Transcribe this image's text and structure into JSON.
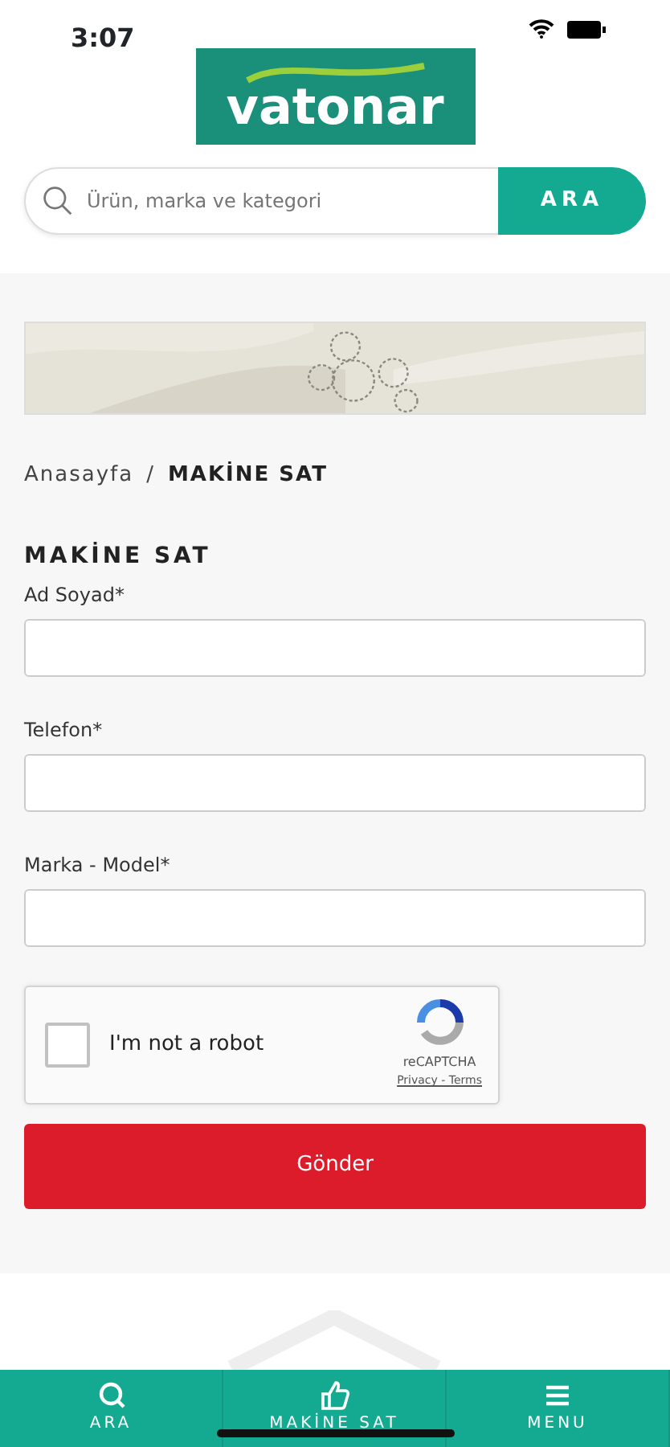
{
  "status_bar": {
    "time": "3:07"
  },
  "logo": {
    "text": "vatonar"
  },
  "search": {
    "placeholder": "Ürün, marka ve kategori",
    "button": "ARA"
  },
  "breadcrumb": [
    {
      "label": "Anasayfa",
      "current": false
    },
    {
      "label": "MAKİNE SAT",
      "current": true
    }
  ],
  "breadcrumb_separator": "/",
  "form": {
    "title": "MAKİNE SAT",
    "fields": [
      {
        "label": "Ad Soyad*"
      },
      {
        "label": "Telefon*"
      },
      {
        "label": "Marka - Model*"
      }
    ],
    "captcha": {
      "label": "I'm not a robot",
      "checked": false,
      "brand": "reCAPTCHA",
      "links": "Privacy - Terms"
    },
    "submit": "Gönder"
  },
  "bottom_nav": [
    {
      "kind": "search",
      "label": "ARA"
    },
    {
      "kind": "like",
      "label": "MAKİNE SAT"
    },
    {
      "kind": "menu",
      "label": "MENU"
    }
  ]
}
